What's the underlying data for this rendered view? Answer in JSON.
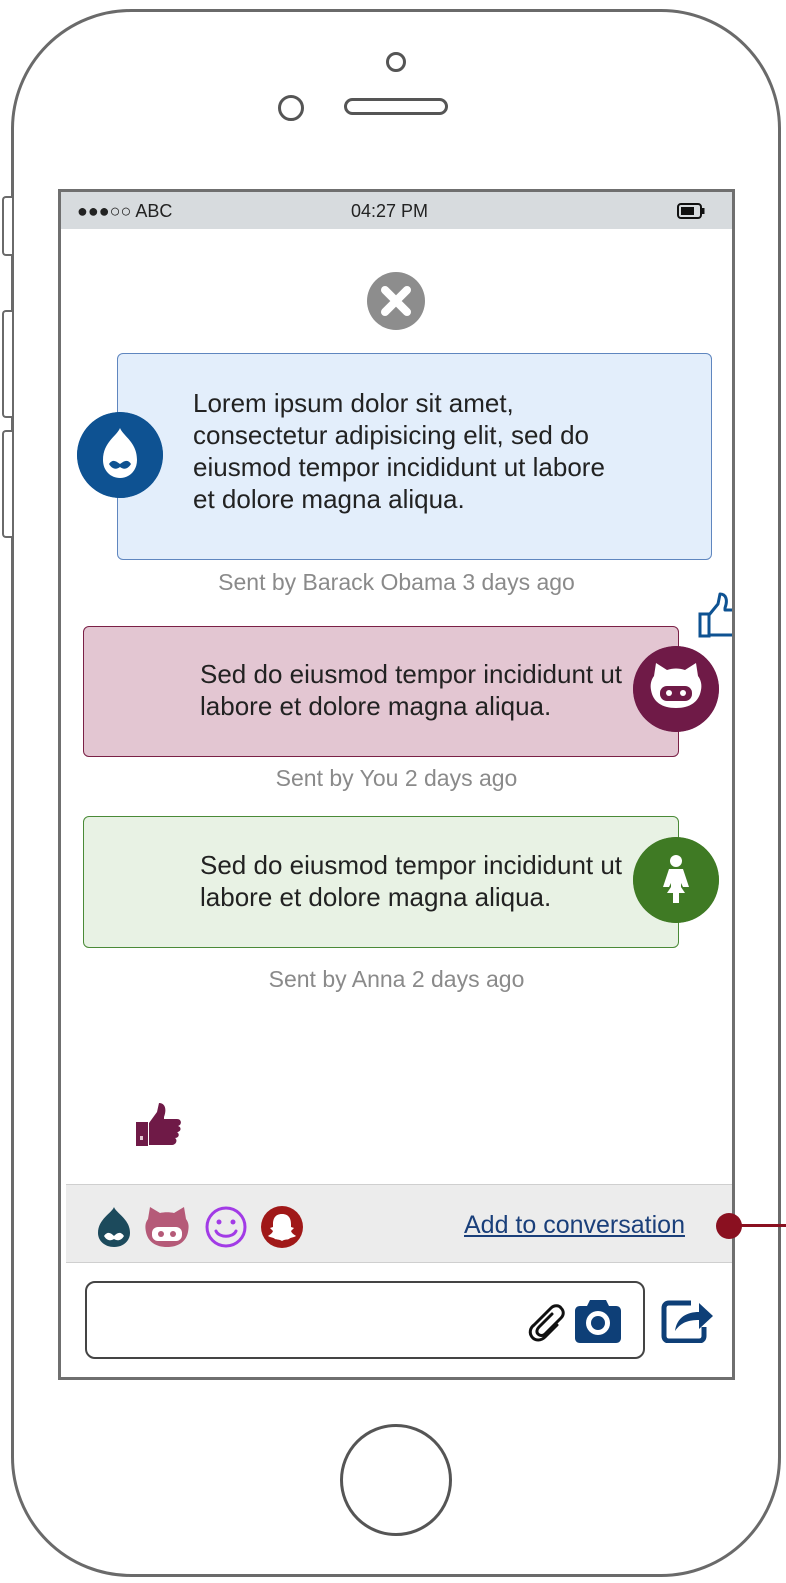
{
  "status_bar": {
    "carrier": "●●●○○ ABC",
    "time": "04:27 PM"
  },
  "messages": [
    {
      "text": "Lorem ipsum dolor sit amet, consectetur adipisicing elit, sed do eiusmod tempor incididunt ut labore et dolore magna aliqua.",
      "meta": "Sent by Barack Obama 3 days ago",
      "avatar_icon": "drupal-icon",
      "like_icon": "thumbs-up-outline-icon",
      "color": "#0e5292"
    },
    {
      "text": "Sed do eiusmod tempor incididunt ut labore et dolore magna aliqua.",
      "meta": "Sent by You 2 days ago",
      "avatar_icon": "github-icon",
      "like_icon": "thumbs-up-icon",
      "color": "#6f1a47"
    },
    {
      "text": "Sed do eiusmod tempor incididunt ut labore et dolore magna aliqua.",
      "meta": "Sent by Anna 2 days ago",
      "avatar_icon": "female-icon",
      "like_icon": "thumbs-up-icon",
      "color": "#3f7a24"
    }
  ],
  "participants": {
    "icons": [
      "drupal-icon",
      "github-icon",
      "smiley-icon",
      "snapchat-icon"
    ],
    "add_label": "Add to conversation"
  },
  "composer": {
    "value": "",
    "icons": [
      "paperclip-icon",
      "camera-icon",
      "share-icon"
    ]
  },
  "colors": {
    "accent_connector": "#8a1020"
  }
}
